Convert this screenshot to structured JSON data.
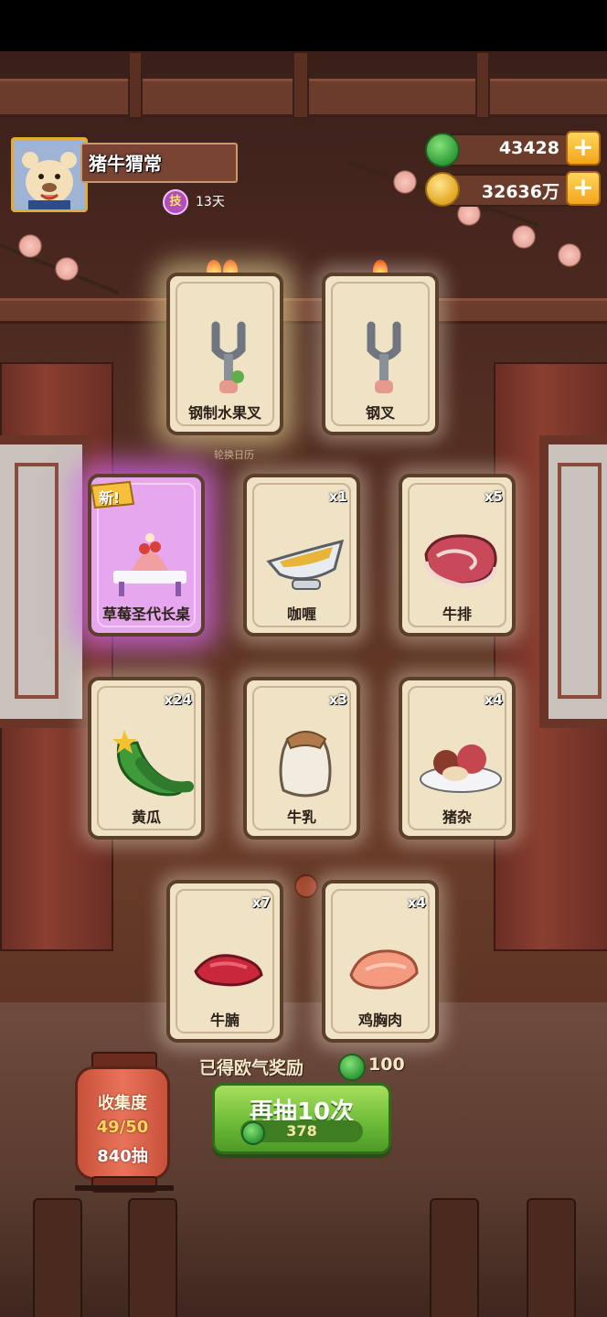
{
  "player": {
    "name": "猪牛猬常",
    "skill_badge": "技",
    "skill_days": "13天"
  },
  "currency": {
    "jade": "43428",
    "coins": "32636万"
  },
  "caption": "轮换日历",
  "new_badge": "新!",
  "cards": [
    {
      "label": "钢制水果叉",
      "count": "",
      "flames": 2
    },
    {
      "label": "钢叉",
      "count": "",
      "flames": 1
    },
    {
      "label": "草莓圣代长桌",
      "count": "",
      "is_new": true
    },
    {
      "label": "咖喱",
      "count": "x1"
    },
    {
      "label": "牛排",
      "count": "x5"
    },
    {
      "label": "黄瓜",
      "count": "x24"
    },
    {
      "label": "牛乳",
      "count": "x3"
    },
    {
      "label": "猪杂",
      "count": "x4"
    },
    {
      "label": "牛腩",
      "count": "x7"
    },
    {
      "label": "鸡胸肉",
      "count": "x4"
    }
  ],
  "reward": {
    "label": "已得欧气奖励",
    "value": "100"
  },
  "draw_button": {
    "label": "再抽10次",
    "cost": "378"
  },
  "collection": {
    "title": "收集度",
    "progress": "49/50",
    "draws": "840抽"
  },
  "colors": {
    "accent_green": "#6fbd39",
    "gold": "#f3a51b",
    "card_bg": "#efe2c5",
    "new_glow": "#d668eb"
  },
  "icons": [
    "jade-icon",
    "coin-icon",
    "plus-icon",
    "fork-icon",
    "curry-boat-icon",
    "steak-icon",
    "cucumber-icon",
    "milk-jar-icon",
    "offal-plate-icon",
    "beef-brisket-icon",
    "chicken-breast-icon",
    "strawberry-sundae-table-icon",
    "flame-icon",
    "lantern-icon"
  ]
}
